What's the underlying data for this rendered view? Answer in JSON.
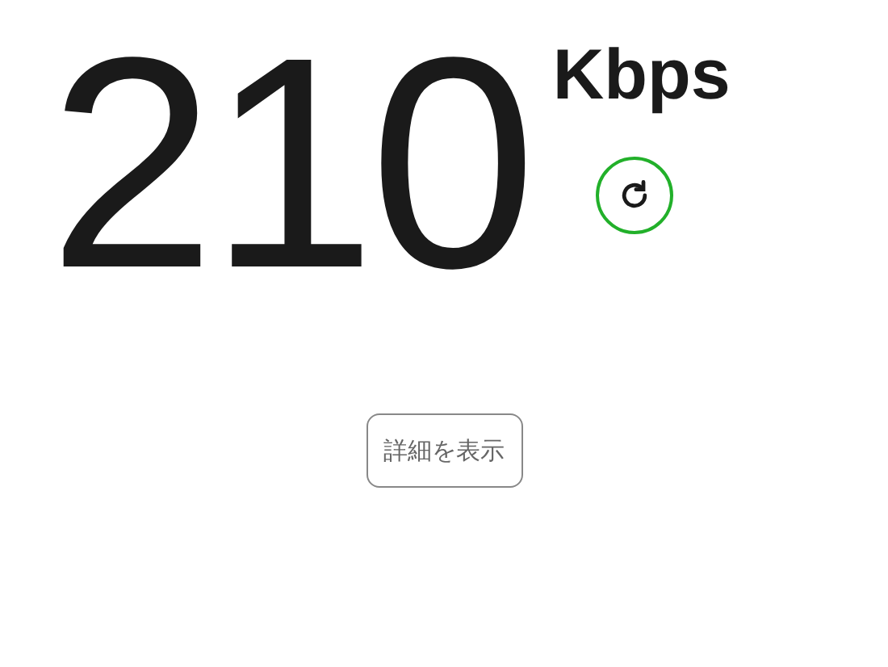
{
  "speed": {
    "value": "210",
    "unit": "Kbps"
  },
  "details_button": {
    "label": "詳細を表示"
  }
}
